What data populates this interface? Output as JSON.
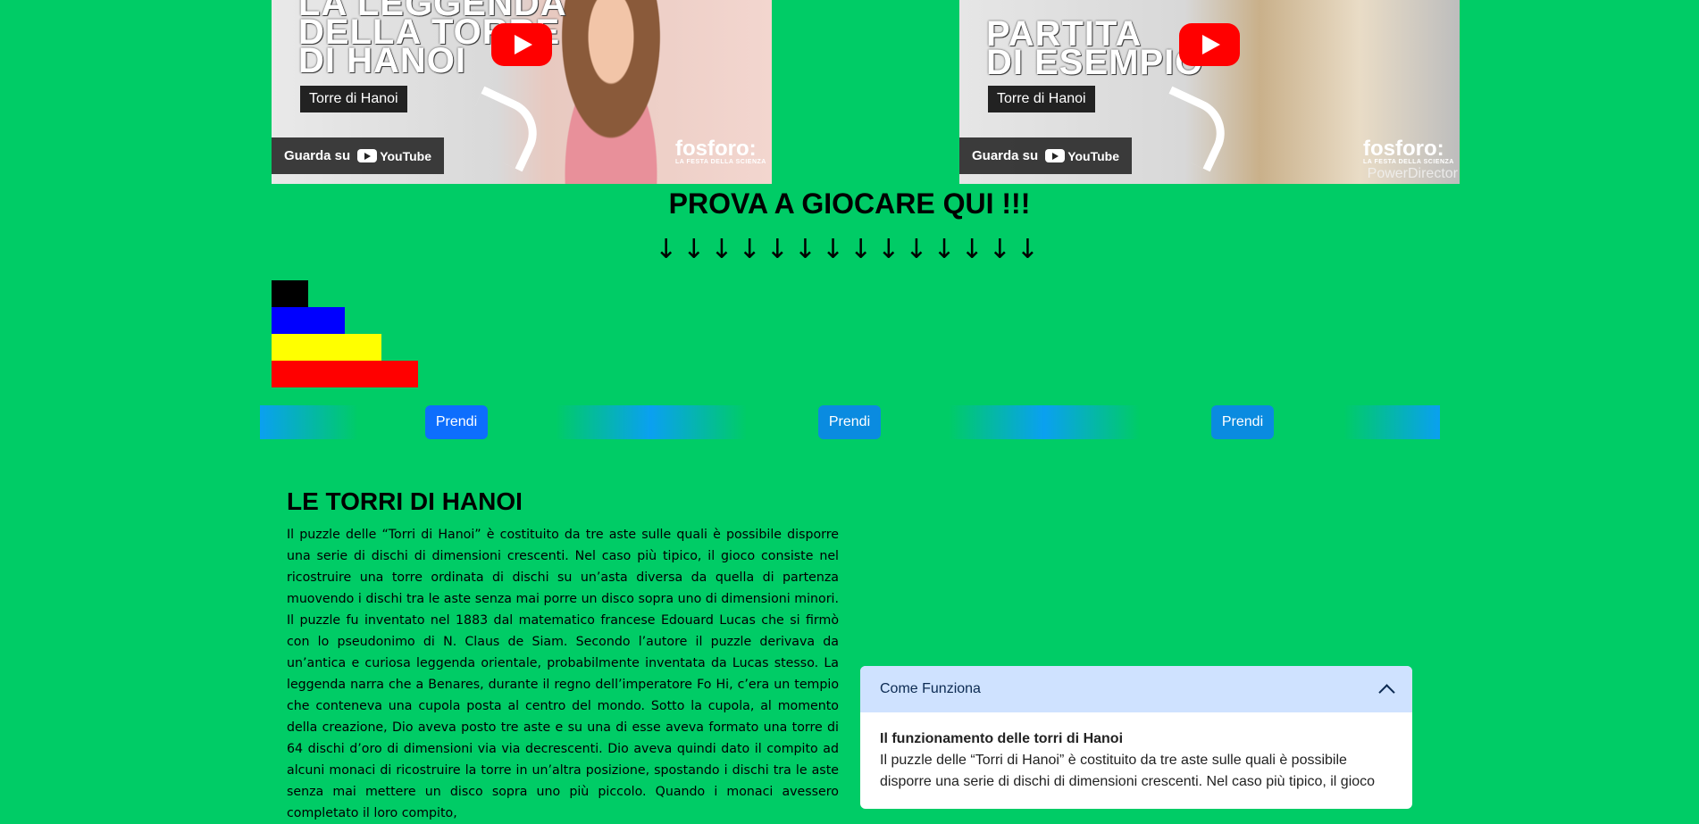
{
  "videos": [
    {
      "title_lines": "LA LEGGENDA\nDELLA TORRE\nDI HANOI",
      "tag": "Torre di Hanoi",
      "watch_label": "Guarda su",
      "yt_label": "YouTube",
      "brand": "fosforo:",
      "brand_sub": "LA FESTA DELLA SCIENZA"
    },
    {
      "title_lines": "PARTITA\nDI ESEMPIO",
      "tag": "Torre di Hanoi",
      "watch_label": "Guarda su",
      "yt_label": "YouTube",
      "brand": "fosforo:",
      "brand_sub": "LA FESTA DELLA SCIENZA",
      "watermark": "PowerDirector"
    }
  ],
  "game": {
    "title": "PROVA A GIOCARE QUI !!!",
    "arrows": "↓↓↓↓↓↓↓↓↓↓↓↓↓↓",
    "discs": [
      {
        "color": "#000000",
        "size": 1
      },
      {
        "color": "#0000ff",
        "size": 2
      },
      {
        "color": "#ffff00",
        "size": 3
      },
      {
        "color": "#ff0000",
        "size": 4
      }
    ],
    "buttons": [
      "Prendi",
      "Prendi",
      "Prendi"
    ]
  },
  "article": {
    "title": "LE TORRI DI HANOI",
    "body": "Il puzzle delle “Torri di Hanoi” è costituito da tre aste sulle quali è possibile disporre una serie di dischi di dimensioni crescenti. Nel caso più tipico, il gioco consiste nel ricostruire una torre ordinata di dischi su un’asta diversa da quella di partenza muovendo i dischi tra le aste senza mai porre un disco sopra uno di dimensioni minori. Il puzzle fu inventato nel 1883 dal matematico francese Edouard Lucas che si firmò con lo pseudonimo di N. Claus de Siam. Secondo l’autore il puzzle derivava da un’antica e curiosa leggenda orientale, probabilmente inventata da Lucas stesso. La leggenda narra che a Benares, durante il regno dell’imperatore Fo Hi, c’era un tempio che conteneva una cupola posta al centro del mondo. Sotto la cupola, al momento della creazione, Dio aveva posto tre aste e su una di esse aveva formato una torre di 64 dischi d’oro di dimensioni via via decrescenti. Dio aveva quindi dato il compito ad alcuni monaci di ricostruire la torre in un’altra posizione, spostando i dischi tra le aste senza mai mettere un disco sopra uno più piccolo. Quando i monaci avessero completato il loro compito,"
  },
  "accordion": {
    "header": "Come Funziona",
    "body_title": "Il funzionamento delle torri di Hanoi",
    "body_text": "Il puzzle delle “Torri di Hanoi” è costituito da tre aste sulle quali è possibile disporre una serie di dischi di dimensioni crescenti. Nel caso più tipico, il gioco"
  },
  "colors": {
    "background": "#00cc66",
    "button_active": "#0d6efd",
    "button": "#0a8be0",
    "accordion_header": "#cfe2ff"
  }
}
